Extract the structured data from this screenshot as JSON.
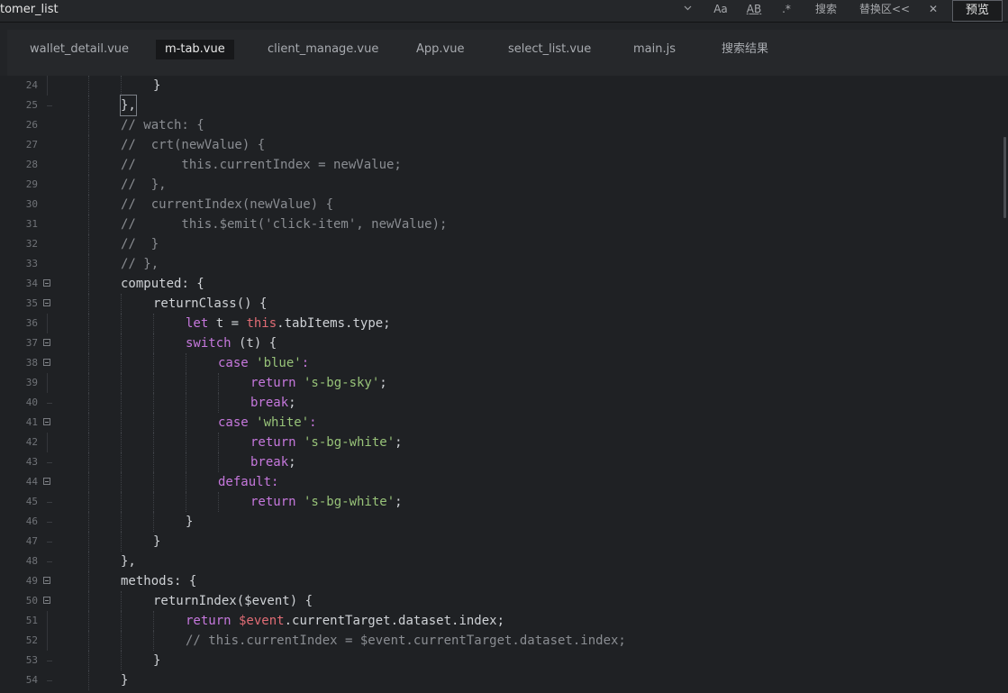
{
  "toolbar": {
    "search_value": "tomer_list",
    "dropdown_glyph": "⌄",
    "match_case_label": "Aa",
    "whole_word_label": "A͟B",
    "regex_label": ".*",
    "search_label": "搜索",
    "replace_label": "替换区<<",
    "close_glyph": "✕",
    "preview_label": "预览"
  },
  "tabs": [
    {
      "label": "wallet_detail.vue",
      "active": false
    },
    {
      "label": "m-tab.vue",
      "active": true
    },
    {
      "label": "client_manage.vue",
      "active": false
    },
    {
      "label": "App.vue",
      "active": false
    },
    {
      "label": "select_list.vue",
      "active": false
    },
    {
      "label": "main.js",
      "active": false
    },
    {
      "label": "搜索结果",
      "active": false
    }
  ],
  "editor": {
    "lines": [
      {
        "n": "24",
        "fold": false
      },
      {
        "n": "25",
        "fold": false
      },
      {
        "n": "26",
        "fold": false
      },
      {
        "n": "27",
        "fold": false
      },
      {
        "n": "28",
        "fold": false
      },
      {
        "n": "29",
        "fold": false
      },
      {
        "n": "30",
        "fold": false
      },
      {
        "n": "31",
        "fold": false
      },
      {
        "n": "32",
        "fold": false
      },
      {
        "n": "33",
        "fold": false
      },
      {
        "n": "34",
        "fold": true
      },
      {
        "n": "35",
        "fold": true
      },
      {
        "n": "36",
        "fold": false
      },
      {
        "n": "37",
        "fold": true
      },
      {
        "n": "38",
        "fold": true
      },
      {
        "n": "39",
        "fold": false
      },
      {
        "n": "40",
        "fold": false
      },
      {
        "n": "41",
        "fold": true
      },
      {
        "n": "42",
        "fold": false
      },
      {
        "n": "43",
        "fold": false
      },
      {
        "n": "44",
        "fold": true
      },
      {
        "n": "45",
        "fold": false
      },
      {
        "n": "46",
        "fold": false
      },
      {
        "n": "47",
        "fold": false
      },
      {
        "n": "48",
        "fold": false
      },
      {
        "n": "49",
        "fold": true
      },
      {
        "n": "50",
        "fold": true
      },
      {
        "n": "51",
        "fold": false
      },
      {
        "n": "52",
        "fold": false
      },
      {
        "n": "53",
        "fold": false
      },
      {
        "n": "54",
        "fold": false
      }
    ],
    "code": {
      "l24_brace": "}",
      "l25_close": "},",
      "l26": "// watch: {",
      "l27": "//  crt(newValue) {",
      "l28": "//      this.currentIndex = newValue;",
      "l29": "//  },",
      "l30": "//  currentIndex(newValue) {",
      "l31": "//      this.$emit('click-item', newValue);",
      "l32": "//  }",
      "l33": "// },",
      "l34_name": "computed",
      "l34_rest": ": {",
      "l35": "returnClass() {",
      "l36_let": "let",
      "l36_a": " t = ",
      "l36_this": "this",
      "l36_b": ".tabItems.type;",
      "l37_switch": "switch",
      "l37_rest": " (t) {",
      "l38_case": "case",
      "l38_str": " 'blue'",
      "l38_colon": ":",
      "l39_return": "return",
      "l39_str": " 's-bg-sky'",
      "l39_semi": ";",
      "l40_break": "break",
      "l40_semi": ";",
      "l41_case": "case",
      "l41_str": " 'white'",
      "l41_colon": ":",
      "l42_return": "return",
      "l42_str": " 's-bg-white'",
      "l42_semi": ";",
      "l43_break": "break",
      "l43_semi": ";",
      "l44_default": "default",
      "l44_colon": ":",
      "l45_return": "return",
      "l45_str": " 's-bg-white'",
      "l45_semi": ";",
      "l46": "}",
      "l47": "}",
      "l48": "},",
      "l49_name": "methods",
      "l49_rest": ": {",
      "l50": "returnIndex($event) {",
      "l51_return": "return",
      "l51_var": " $event",
      "l51_rest": ".currentTarget.dataset.index;",
      "l52": "// this.currentIndex = $event.currentTarget.dataset.index;",
      "l53": "}",
      "l54": "}"
    }
  },
  "colors": {
    "background": "#1f2124",
    "keyword": "#c678dd",
    "string": "#98c379",
    "this_keyword": "#e06c75",
    "comment": "#8a8d92",
    "text": "#cfd2d6"
  }
}
